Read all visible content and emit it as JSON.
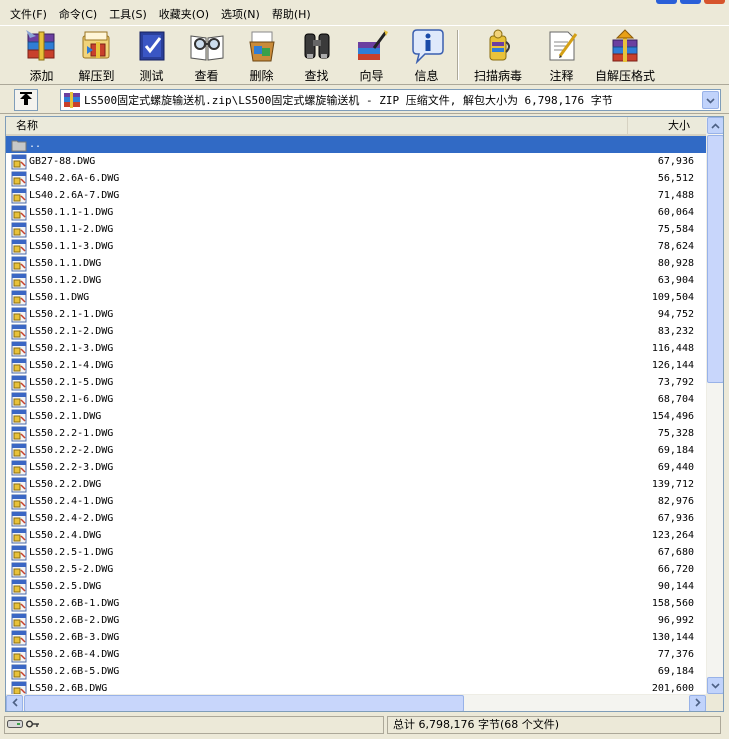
{
  "menu": [
    "文件(F)",
    "命令(C)",
    "工具(S)",
    "收藏夹(O)",
    "选项(N)",
    "帮助(H)"
  ],
  "toolbar": [
    {
      "label": "添加",
      "icon": "add-archive-icon"
    },
    {
      "label": "解压到",
      "icon": "extract-to-icon"
    },
    {
      "label": "测试",
      "icon": "test-icon"
    },
    {
      "label": "查看",
      "icon": "view-icon"
    },
    {
      "label": "删除",
      "icon": "delete-icon"
    },
    {
      "label": "查找",
      "icon": "find-icon"
    },
    {
      "label": "向导",
      "icon": "wizard-icon"
    },
    {
      "label": "信息",
      "icon": "info-icon"
    },
    {
      "label": "扫描病毒",
      "icon": "virus-scan-icon"
    },
    {
      "label": "注释",
      "icon": "comment-icon"
    },
    {
      "label": "自解压格式",
      "icon": "sfx-icon"
    }
  ],
  "address": {
    "path": "LS500固定式螺旋输送机.zip\\LS500固定式螺旋输送机 - ZIP 压缩文件, 解包大小为 6,798,176 字节"
  },
  "columns": {
    "name": "名称",
    "size": "大小"
  },
  "files": [
    {
      "name": "..",
      "size": "",
      "selected": true,
      "folder": true
    },
    {
      "name": "GB27-88.DWG",
      "size": "67,936"
    },
    {
      "name": "LS40.2.6A-6.DWG",
      "size": "56,512"
    },
    {
      "name": "LS40.2.6A-7.DWG",
      "size": "71,488"
    },
    {
      "name": "LS50.1.1-1.DWG",
      "size": "60,064"
    },
    {
      "name": "LS50.1.1-2.DWG",
      "size": "75,584"
    },
    {
      "name": "LS50.1.1-3.DWG",
      "size": "78,624"
    },
    {
      "name": "LS50.1.1.DWG",
      "size": "80,928"
    },
    {
      "name": "LS50.1.2.DWG",
      "size": "63,904"
    },
    {
      "name": "LS50.1.DWG",
      "size": "109,504"
    },
    {
      "name": "LS50.2.1-1.DWG",
      "size": "94,752"
    },
    {
      "name": "LS50.2.1-2.DWG",
      "size": "83,232"
    },
    {
      "name": "LS50.2.1-3.DWG",
      "size": "116,448"
    },
    {
      "name": "LS50.2.1-4.DWG",
      "size": "126,144"
    },
    {
      "name": "LS50.2.1-5.DWG",
      "size": "73,792"
    },
    {
      "name": "LS50.2.1-6.DWG",
      "size": "68,704"
    },
    {
      "name": "LS50.2.1.DWG",
      "size": "154,496"
    },
    {
      "name": "LS50.2.2-1.DWG",
      "size": "75,328"
    },
    {
      "name": "LS50.2.2-2.DWG",
      "size": "69,184"
    },
    {
      "name": "LS50.2.2-3.DWG",
      "size": "69,440"
    },
    {
      "name": "LS50.2.2.DWG",
      "size": "139,712"
    },
    {
      "name": "LS50.2.4-1.DWG",
      "size": "82,976"
    },
    {
      "name": "LS50.2.4-2.DWG",
      "size": "67,936"
    },
    {
      "name": "LS50.2.4.DWG",
      "size": "123,264"
    },
    {
      "name": "LS50.2.5-1.DWG",
      "size": "67,680"
    },
    {
      "name": "LS50.2.5-2.DWG",
      "size": "66,720"
    },
    {
      "name": "LS50.2.5.DWG",
      "size": "90,144"
    },
    {
      "name": "LS50.2.6B-1.DWG",
      "size": "158,560"
    },
    {
      "name": "LS50.2.6B-2.DWG",
      "size": "96,992"
    },
    {
      "name": "LS50.2.6B-3.DWG",
      "size": "130,144"
    },
    {
      "name": "LS50.2.6B-4.DWG",
      "size": "77,376"
    },
    {
      "name": "LS50.2.6B-5.DWG",
      "size": "69,184"
    },
    {
      "name": "LS50.2.6B.DWG",
      "size": "201,600"
    }
  ],
  "status": {
    "summary": "总计 6,798,176 字节(68 个文件)"
  },
  "colors": {
    "selection": "#316ac5",
    "chrome": "#ece9d8"
  }
}
